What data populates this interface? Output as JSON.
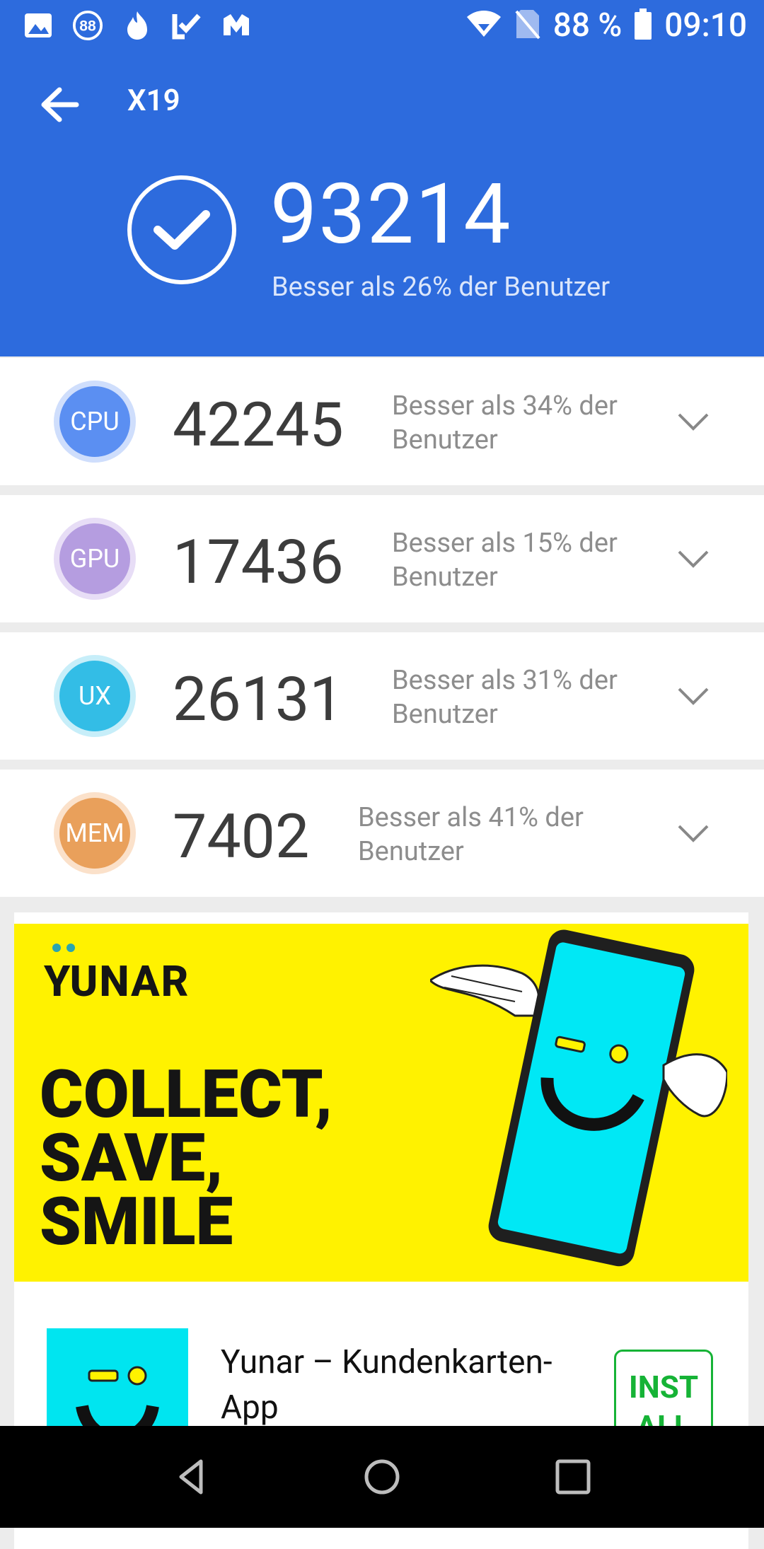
{
  "status_bar": {
    "battery": "88 %",
    "time": "09:10",
    "left_icons": [
      "gallery-icon",
      "notification-88-icon",
      "flame-icon",
      "check-app-icon",
      "m-app-icon"
    ],
    "right_icons": [
      "wifi-icon",
      "no-sim-icon",
      "battery-icon"
    ]
  },
  "header": {
    "title": "X19",
    "total_score": "93214",
    "total_subtitle": "Besser als 26% der Benutzer",
    "color": "#2d6bdd"
  },
  "scores": [
    {
      "badge": "CPU",
      "value": "42245",
      "desc": "Besser als 34% der Benutzer",
      "color": "#5b8ff2"
    },
    {
      "badge": "GPU",
      "value": "17436",
      "desc": "Besser als 15% der Benutzer",
      "color": "#b59de0"
    },
    {
      "badge": "UX",
      "value": "26131",
      "desc": "Besser als 31% der Benutzer",
      "color": "#33bde6"
    },
    {
      "badge": "MEM",
      "value": "7402",
      "desc": "Besser als 41% der Benutzer",
      "color": "#e9a05b"
    }
  ],
  "ad": {
    "brand": "YUNAR",
    "tagline_line1": "COLLECT,",
    "tagline_line2": "SAVE,",
    "tagline_line3": "SMILE",
    "app_name": "Yunar – Kundenkarten-App",
    "install_label": "INST ALL"
  },
  "nav": {
    "icons": [
      "back-triangle-icon",
      "home-circle-icon",
      "recents-square-icon"
    ]
  }
}
